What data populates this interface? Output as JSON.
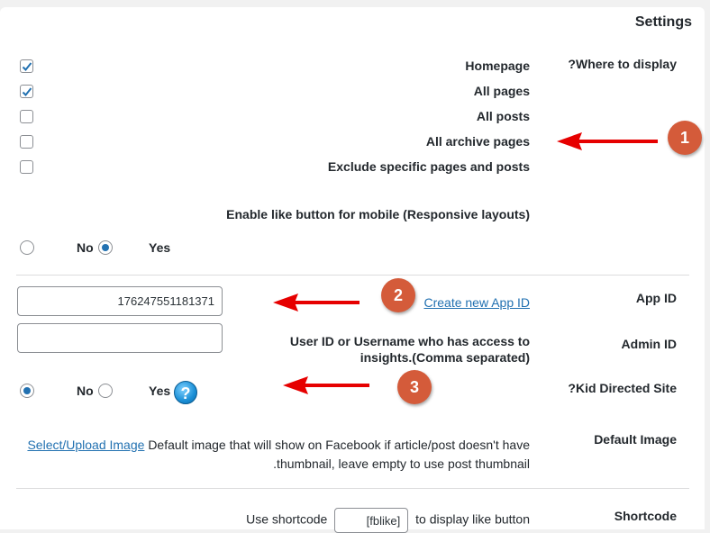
{
  "settings": {
    "title": "Settings",
    "where_label": "?Where to display",
    "display_options": [
      {
        "label": "Homepage",
        "checked": true
      },
      {
        "label": "All pages",
        "checked": true
      },
      {
        "label": "All posts",
        "checked": false
      },
      {
        "label": "All archive pages",
        "checked": false
      },
      {
        "label": "Exclude specific pages and posts",
        "checked": false
      }
    ],
    "mobile": {
      "label": "Enable like button for mobile (Responsive layouts)",
      "no": "No",
      "yes": "Yes",
      "selected": "yes"
    },
    "app_id": {
      "label": "App ID",
      "value": "176247551181371",
      "link": "Create new App ID"
    },
    "admin_id": {
      "label": "Admin ID",
      "description_line1": "User ID or Username who has access to",
      "description_line2": "insights.(Comma separated)",
      "value": ""
    },
    "kid_directed": {
      "label": "?Kid Directed Site",
      "no": "No",
      "yes": "Yes",
      "selected": "no",
      "help_icon": "?"
    },
    "default_image": {
      "label": "Default Image",
      "link": "Select/Upload Image",
      "description_line1": "Default image that will show on Facebook if article/post doesn't have",
      "description_line2": ".thumbnail, leave empty to use post thumbnail"
    },
    "shortcode": {
      "label": "Shortcode",
      "prefix": "Use shortcode",
      "value": "[fblike]",
      "suffix": "to display like button"
    }
  },
  "annotations": [
    {
      "number": "1",
      "color": "#d45b3a"
    },
    {
      "number": "2",
      "color": "#d45b3a"
    },
    {
      "number": "3",
      "color": "#d45b3a"
    }
  ],
  "colors": {
    "accent": "#2271b1",
    "arrow": "#e60000"
  }
}
